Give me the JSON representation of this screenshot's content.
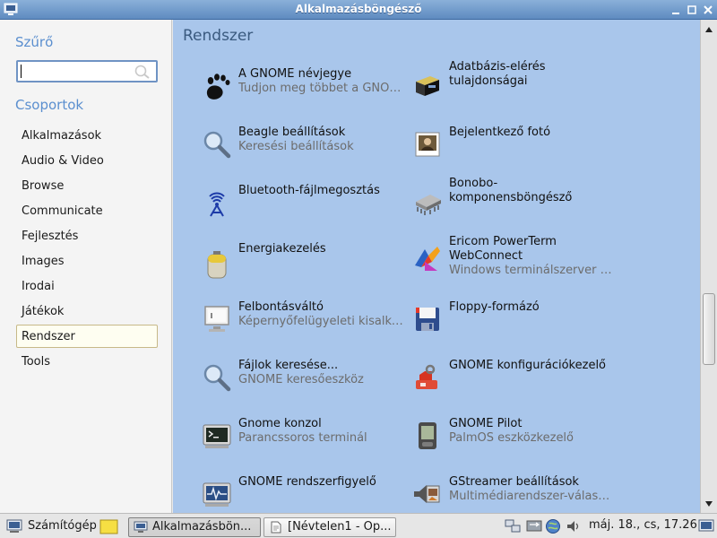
{
  "window": {
    "title": "Alkalmazásböngésző"
  },
  "sidebar": {
    "filter_title": "Szűrő",
    "search": {
      "value": "",
      "placeholder": ""
    },
    "groups_title": "Csoportok",
    "groups": [
      {
        "label": "Alkalmazások"
      },
      {
        "label": "Audio & Video"
      },
      {
        "label": "Browse"
      },
      {
        "label": "Communicate"
      },
      {
        "label": "Fejlesztés"
      },
      {
        "label": "Images"
      },
      {
        "label": "Irodai"
      },
      {
        "label": "Játékok"
      },
      {
        "label": "Rendszer",
        "selected": true
      },
      {
        "label": "Tools"
      }
    ]
  },
  "content": {
    "title": "Rendszer",
    "items": [
      {
        "name": "A GNOME névjegye",
        "desc": "Tudjon meg többet a GNOME-ról",
        "icon": "gnome-foot-icon"
      },
      {
        "name": "Adatbázis-elérés tulajdonságai",
        "desc": "",
        "icon": "database-icon"
      },
      {
        "name": "Beagle beállítások",
        "desc": "Keresési beállítások",
        "icon": "magnifier-icon"
      },
      {
        "name": "Bejelentkező fotó",
        "desc": "",
        "icon": "photo-icon"
      },
      {
        "name": "Bluetooth-fájlmegosztás",
        "desc": "",
        "icon": "bluetooth-icon"
      },
      {
        "name": "Bonobo-komponensböngésző",
        "desc": "",
        "icon": "chip-icon"
      },
      {
        "name": "Energiakezelés",
        "desc": "",
        "icon": "battery-icon"
      },
      {
        "name": "Ericom PowerTerm WebConnect",
        "desc": "Windows terminálszerver elérés",
        "icon": "ericom-icon"
      },
      {
        "name": "Felbontásváltó",
        "desc": "Képernyőfelügyeleti kisalkalmazás",
        "icon": "monitor-icon"
      },
      {
        "name": "Floppy-formázó",
        "desc": "",
        "icon": "floppy-icon"
      },
      {
        "name": "Fájlok keresése...",
        "desc": "GNOME keresőeszköz",
        "icon": "search-files-icon"
      },
      {
        "name": "GNOME konfigurációkezelő",
        "desc": "",
        "icon": "config-icon"
      },
      {
        "name": "Gnome konzol",
        "desc": "Parancssoros terminál",
        "icon": "terminal-icon"
      },
      {
        "name": "GNOME Pilot",
        "desc": "PalmOS eszközkezelő",
        "icon": "pda-icon"
      },
      {
        "name": "GNOME rendszerfigyelő",
        "desc": "",
        "icon": "system-monitor-icon"
      },
      {
        "name": "GStreamer beállítások",
        "desc": "Multimédiarendszer-választó",
        "icon": "gstreamer-icon"
      }
    ]
  },
  "taskbar": {
    "computer_label": "Számítógép",
    "tasks": [
      {
        "label": "Alkalmazásbön...",
        "pressed": true
      },
      {
        "label": "[Névtelen1 - Op..."
      }
    ],
    "clock": "máj. 18., cs, 17.26"
  },
  "colors": {
    "content_bg": "#a9c6eb",
    "accent": "#5b8fcf",
    "titlebar": "#6f98c9"
  }
}
